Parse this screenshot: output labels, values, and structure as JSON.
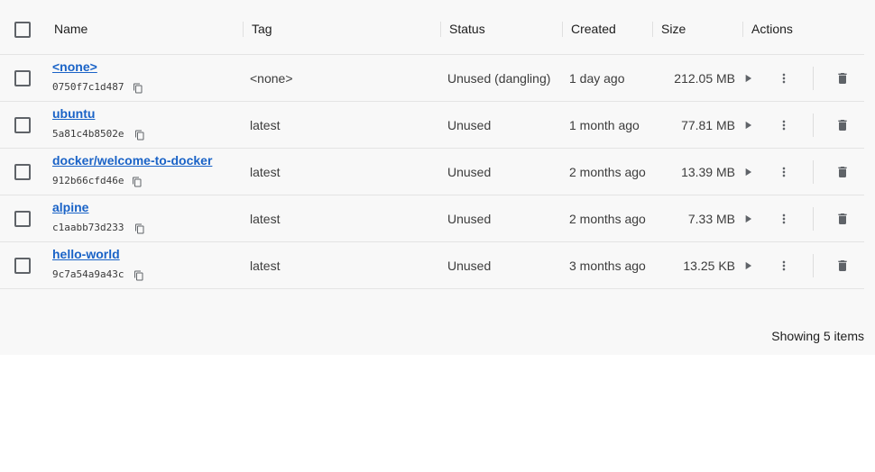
{
  "header": {
    "select_all": "select-all",
    "columns": {
      "name": "Name",
      "tag": "Tag",
      "status": "Status",
      "created": "Created",
      "size": "Size",
      "actions": "Actions"
    }
  },
  "rows": [
    {
      "name": "<none>",
      "id": "0750f7c1d487",
      "tag": "<none>",
      "status": "Unused (dangling)",
      "created": "1 day ago",
      "size": "212.05 MB"
    },
    {
      "name": "ubuntu",
      "id": "5a81c4b8502e",
      "tag": "latest",
      "status": "Unused",
      "created": "1 month ago",
      "size": "77.81 MB"
    },
    {
      "name": "docker/welcome-to-docker",
      "id": "912b66cfd46e",
      "tag": "latest",
      "status": "Unused",
      "created": "2 months ago",
      "size": "13.39 MB"
    },
    {
      "name": "alpine",
      "id": "c1aabb73d233",
      "tag": "latest",
      "status": "Unused",
      "created": "2 months ago",
      "size": "7.33 MB"
    },
    {
      "name": "hello-world",
      "id": "9c7a54a9a43c",
      "tag": "latest",
      "status": "Unused",
      "created": "3 months ago",
      "size": "13.25 KB"
    }
  ],
  "footer": {
    "count_text": "Showing 5 items"
  },
  "icons": {
    "copy": "copy-icon",
    "run": "play-icon",
    "more": "more-vert-icon",
    "delete": "trash-icon"
  },
  "colors": {
    "link": "#1a63c7",
    "panel_bg": "#f8f8f8",
    "icon": "#5f6368"
  }
}
